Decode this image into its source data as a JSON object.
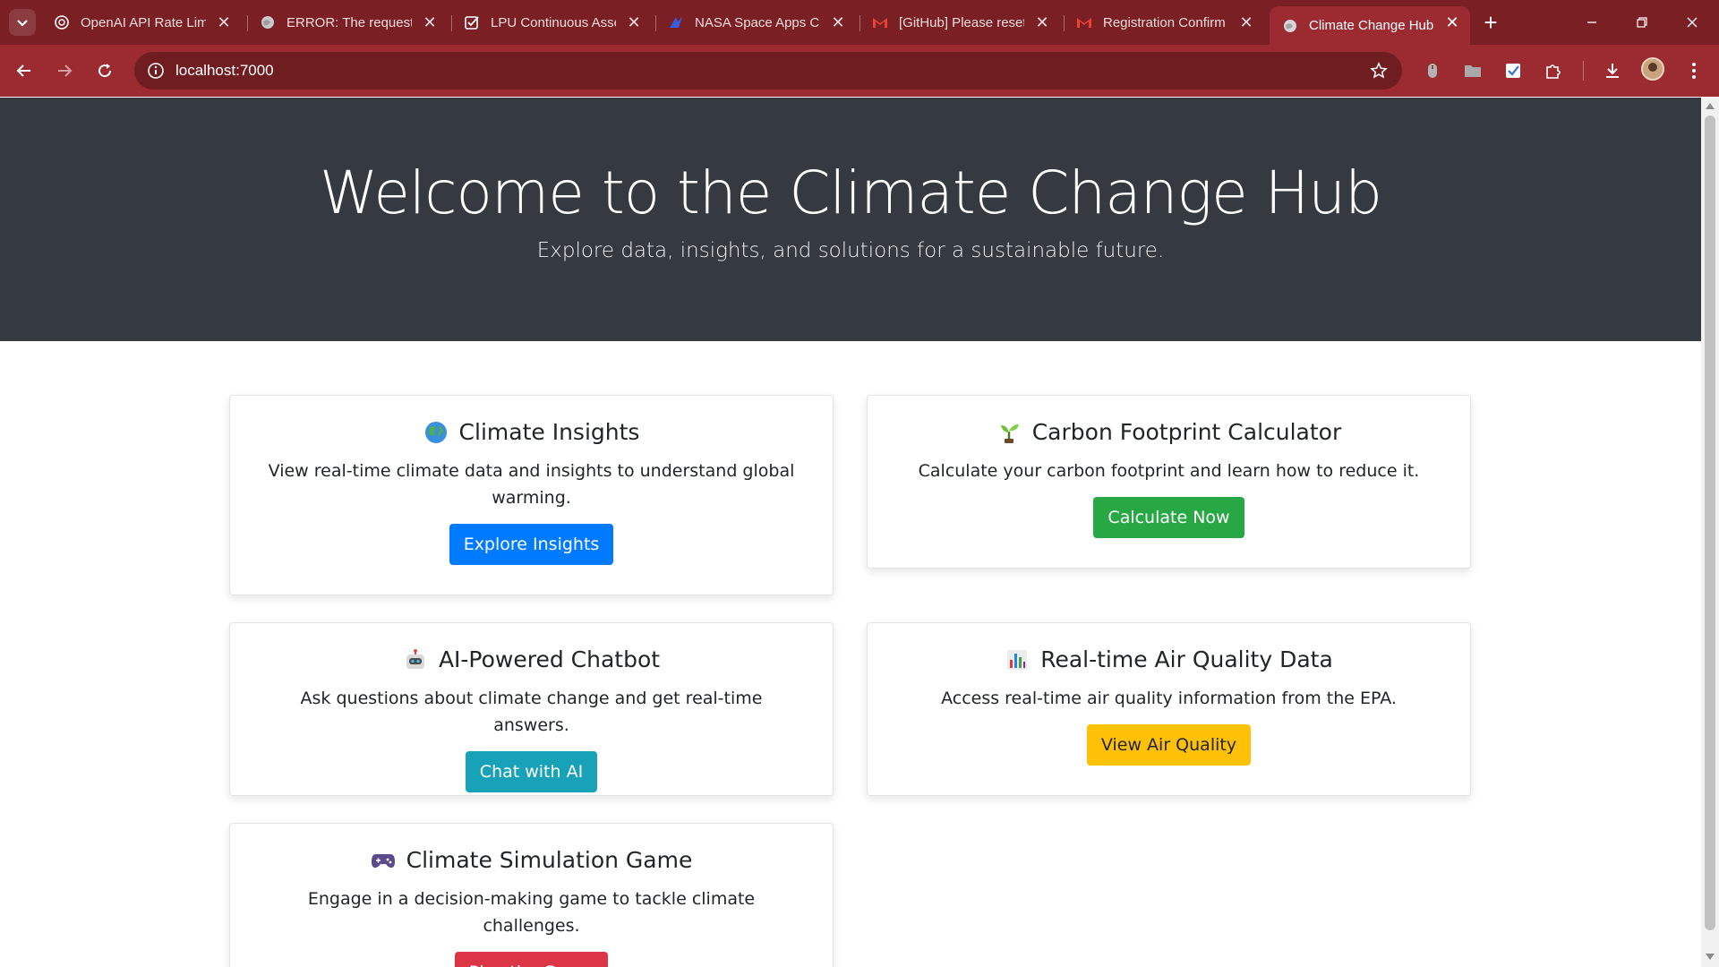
{
  "browser": {
    "tabs": [
      {
        "title": "OpenAI API Rate Lim",
        "favicon": "openai-icon"
      },
      {
        "title": "ERROR: The request c",
        "favicon": "globe-icon"
      },
      {
        "title": "LPU Continuous Asse",
        "favicon": "checkbox-icon"
      },
      {
        "title": "NASA Space Apps Ch",
        "favicon": "nasa-icon"
      },
      {
        "title": "[GitHub] Please reset",
        "favicon": "gmail-icon"
      },
      {
        "title": "Registration Confirm",
        "favicon": "gmail-icon"
      },
      {
        "title": "Climate Change Hub",
        "favicon": "globe-icon",
        "active": true
      }
    ],
    "url": "localhost:7000",
    "colors": {
      "tabbar": "#7a1f24",
      "toolbar": "#9b2b30",
      "omnibox": "#6f1d21"
    }
  },
  "hero": {
    "title": "Welcome to the Climate Change Hub",
    "subtitle": "Explore data, insights, and solutions for a sustainable future."
  },
  "cards": [
    {
      "icon": "globe-emoji",
      "title": "Climate Insights",
      "text": "View real-time climate data and insights to understand global warming.",
      "button": "Explore Insights",
      "color": "#007bff"
    },
    {
      "icon": "seedling-emoji",
      "title": "Carbon Footprint Calculator",
      "text": "Calculate your carbon footprint and learn how to reduce it.",
      "button": "Calculate Now",
      "color": "#28a745"
    },
    {
      "icon": "robot-emoji",
      "title": "AI-Powered Chatbot",
      "text": "Ask questions about climate change and get real-time answers.",
      "button": "Chat with AI",
      "color": "#17a2b8"
    },
    {
      "icon": "bar-chart-emoji",
      "title": "Real-time Air Quality Data",
      "text": "Access real-time air quality information from the EPA.",
      "button": "View Air Quality",
      "color": "#ffc107"
    },
    {
      "icon": "game-controller-emoji",
      "title": "Climate Simulation Game",
      "text": "Engage in a decision-making game to tackle climate challenges.",
      "button": "Play the Game",
      "color": "#dc3545"
    }
  ]
}
